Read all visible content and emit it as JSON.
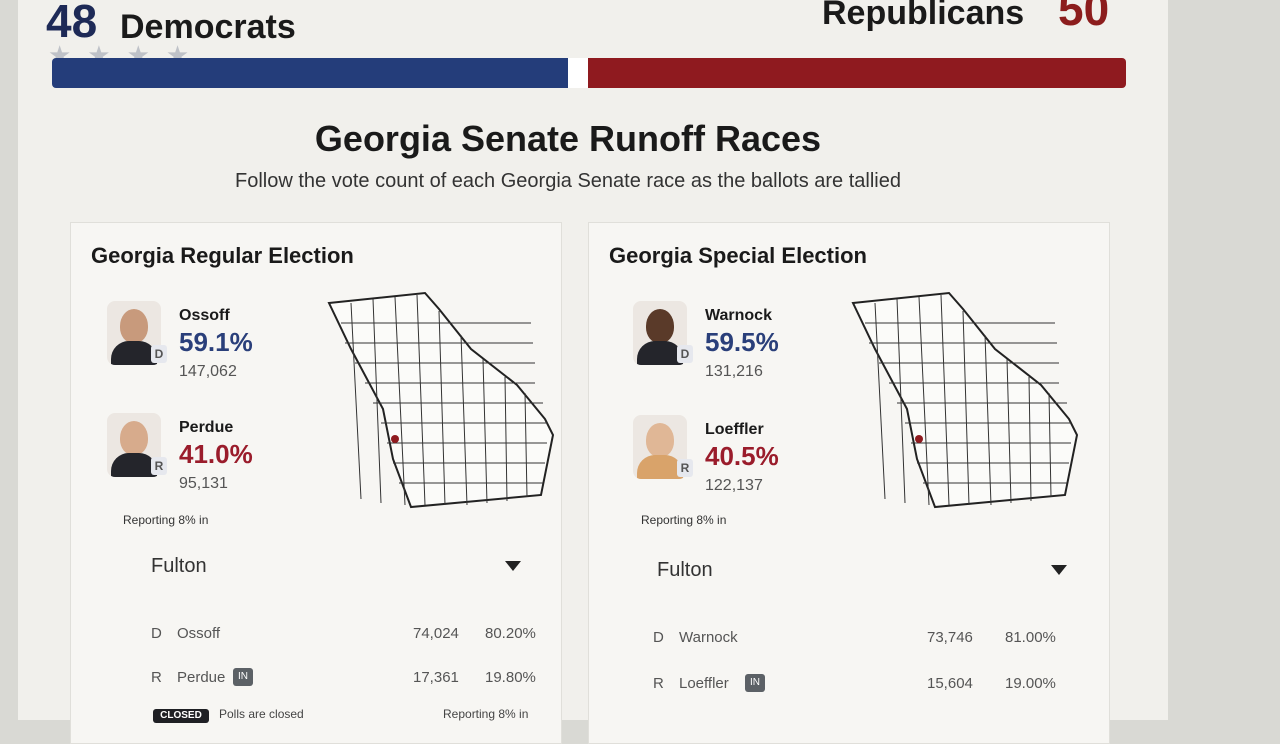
{
  "scoreboard": {
    "dem_count": "48",
    "dem_label": "Democrats",
    "rep_label": "Republicans",
    "rep_count": "50",
    "dem_seats": 48,
    "rep_seats": 50,
    "dem_color": "#243d7a",
    "rep_color": "#8f1a1f"
  },
  "page": {
    "title": "Georgia Senate Runoff Races",
    "subtitle": "Follow the vote count of each Georgia Senate race as the ballots are tallied"
  },
  "races": [
    {
      "title": "Georgia Regular Election",
      "candidates": [
        {
          "name": "Ossoff",
          "party": "D",
          "pct": "59.1%",
          "votes": "147,062",
          "avatar": "ossoff-photo"
        },
        {
          "name": "Perdue",
          "party": "R",
          "pct": "41.0%",
          "votes": "95,131",
          "avatar": "perdue-photo"
        }
      ],
      "reporting": "Reporting 8% in",
      "county_select": "Fulton",
      "county_rows": [
        {
          "party": "D",
          "name": "Ossoff",
          "votes": "74,024",
          "pct": "80.20%",
          "incumbent": false
        },
        {
          "party": "R",
          "name": "Perdue",
          "votes": "17,361",
          "pct": "19.80%",
          "incumbent": true
        }
      ],
      "closed_label": "CLOSED",
      "polls_label": "Polls are closed",
      "reporting_footer": "Reporting 8% in"
    },
    {
      "title": "Georgia Special Election",
      "candidates": [
        {
          "name": "Warnock",
          "party": "D",
          "pct": "59.5%",
          "votes": "131,216",
          "avatar": "warnock-photo"
        },
        {
          "name": "Loeffler",
          "party": "R",
          "pct": "40.5%",
          "votes": "122,137",
          "avatar": "loeffler-photo"
        }
      ],
      "reporting": "Reporting 8% in",
      "county_select": "Fulton",
      "county_rows": [
        {
          "party": "D",
          "name": "Warnock",
          "votes": "73,746",
          "pct": "81.00%",
          "incumbent": false
        },
        {
          "party": "R",
          "name": "Loeffler",
          "votes": "15,604",
          "pct": "19.00%",
          "incumbent": true
        }
      ]
    }
  ],
  "icons": {
    "dropdown": "chevron-down-icon",
    "map": "georgia-county-map",
    "incumbent": "incumbent-badge-icon"
  }
}
